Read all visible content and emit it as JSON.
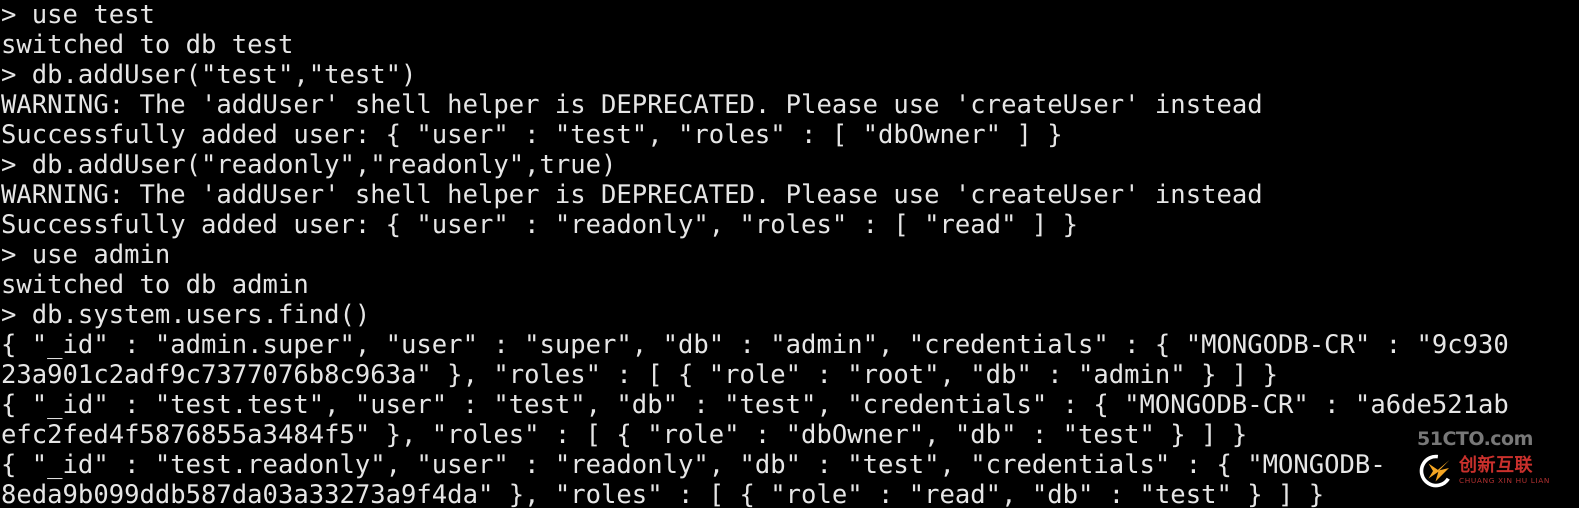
{
  "terminal": {
    "title": "MongoDB shell session",
    "background_color": "#000000",
    "text_color": "#e6e6e6",
    "prompt": ">",
    "lines": [
      "> use test",
      "switched to db test",
      "> db.addUser(\"test\",\"test\")",
      "WARNING: The 'addUser' shell helper is DEPRECATED. Please use 'createUser' instead",
      "Successfully added user: { \"user\" : \"test\", \"roles\" : [ \"dbOwner\" ] }",
      "> db.addUser(\"readonly\",\"readonly\",true)",
      "WARNING: The 'addUser' shell helper is DEPRECATED. Please use 'createUser' instead",
      "Successfully added user: { \"user\" : \"readonly\", \"roles\" : [ \"read\" ] }",
      "> use admin",
      "switched to db admin",
      "> db.system.users.find()",
      "{ \"_id\" : \"admin.super\", \"user\" : \"super\", \"db\" : \"admin\", \"credentials\" : { \"MONGODB-CR\" : \"9c930",
      "23a901c2adf9c7377076b8c963a\" }, \"roles\" : [ { \"role\" : \"root\", \"db\" : \"admin\" } ] }",
      "{ \"_id\" : \"test.test\", \"user\" : \"test\", \"db\" : \"test\", \"credentials\" : { \"MONGODB-CR\" : \"a6de521ab",
      "efc2fed4f5876855a3484f5\" }, \"roles\" : [ { \"role\" : \"dbOwner\", \"db\" : \"test\" } ] }",
      "{ \"_id\" : \"test.readonly\", \"user\" : \"readonly\", \"db\" : \"test\", \"credentials\" : { \"MONGODB-",
      "8eda9b099ddb587da03a33273a9f4da\" }, \"roles\" : [ { \"role\" : \"read\", \"db\" : \"test\" } ] }"
    ],
    "commands": [
      "use test",
      "db.addUser(\"test\",\"test\")",
      "db.addUser(\"readonly\",\"readonly\",true)",
      "use admin",
      "db.system.users.find()"
    ],
    "users": [
      {
        "_id": "admin.super",
        "user": "super",
        "db": "admin",
        "credentials_type": "MONGODB-CR",
        "credentials_hash": "9c93023a901c2adf9c7377076b8c963a",
        "role": "root",
        "role_db": "admin"
      },
      {
        "_id": "test.test",
        "user": "test",
        "db": "test",
        "credentials_type": "MONGODB-CR",
        "credentials_hash": "a6de521abefc2fed4f5876855a3484f5",
        "role": "dbOwner",
        "role_db": "test"
      },
      {
        "_id": "test.readonly",
        "user": "readonly",
        "db": "test",
        "credentials_type": "MONGODB-CR",
        "credentials_hash": "8eda9b099ddb587da03a33273a9f4da",
        "role": "read",
        "role_db": "test"
      }
    ]
  },
  "watermark": {
    "site": "51CTO.com",
    "brand_cn": "创新互联",
    "brand_pinyin": "CHUANG XIN HU LIAN",
    "mark_icon": "cx-logo-icon",
    "site_color": "#8d8d8d",
    "brand_color": "#c9302c",
    "accent_color": "#f5a623"
  }
}
